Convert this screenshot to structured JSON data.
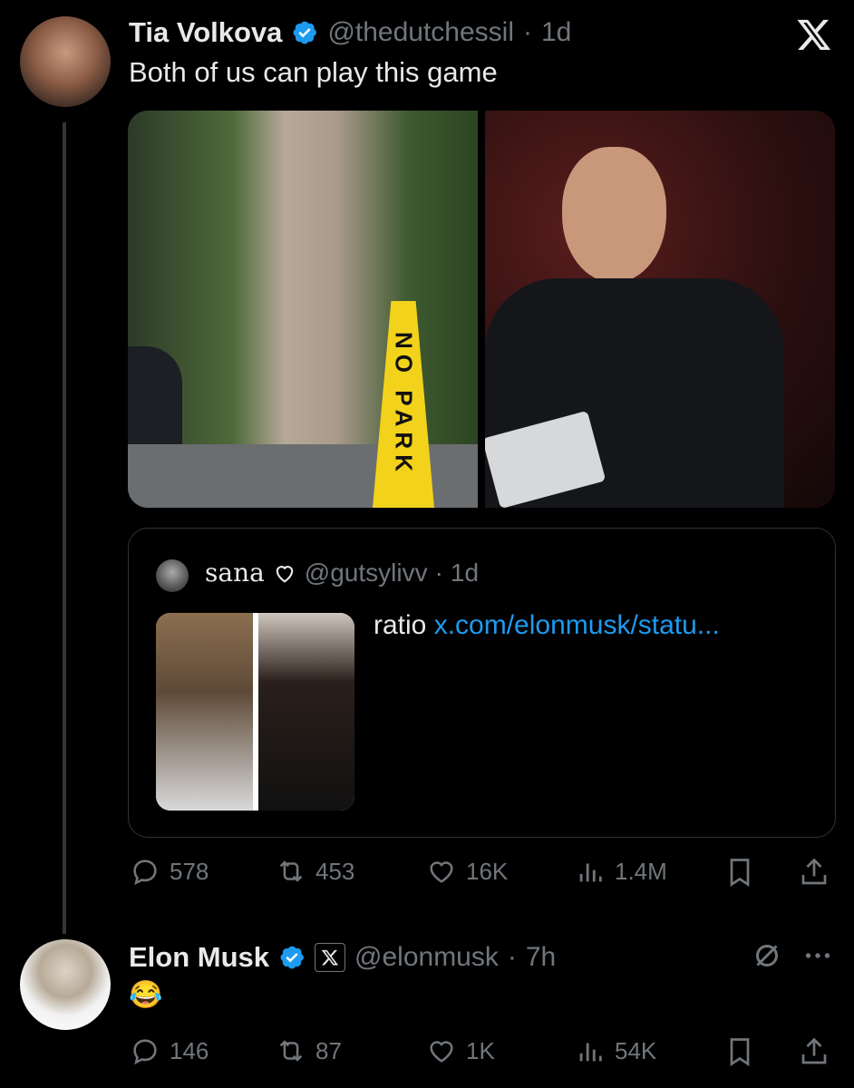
{
  "tweet": {
    "author_name": "Tia Volkova",
    "handle": "@thedutchessil",
    "time": "1d",
    "text": "Both of us can play this game",
    "sign_text": "NO PARK",
    "quote": {
      "author_name": "sana",
      "handle": "@gutsylivv",
      "time": "1d",
      "text": "ratio",
      "link": "x.com/elonmusk/statu..."
    },
    "stats": {
      "replies": "578",
      "reposts": "453",
      "likes": "16K",
      "views": "1.4M"
    }
  },
  "reply": {
    "author_name": "Elon Musk",
    "handle": "@elonmusk",
    "time": "7h",
    "text": "😂",
    "stats": {
      "replies": "146",
      "reposts": "87",
      "likes": "1K",
      "views": "54K"
    }
  },
  "colors": {
    "background": "#000000",
    "text": "#e7e9ea",
    "secondary": "#71767b",
    "verified": "#1d9bf0",
    "link": "#1d9bf0",
    "border": "#2f3336"
  }
}
